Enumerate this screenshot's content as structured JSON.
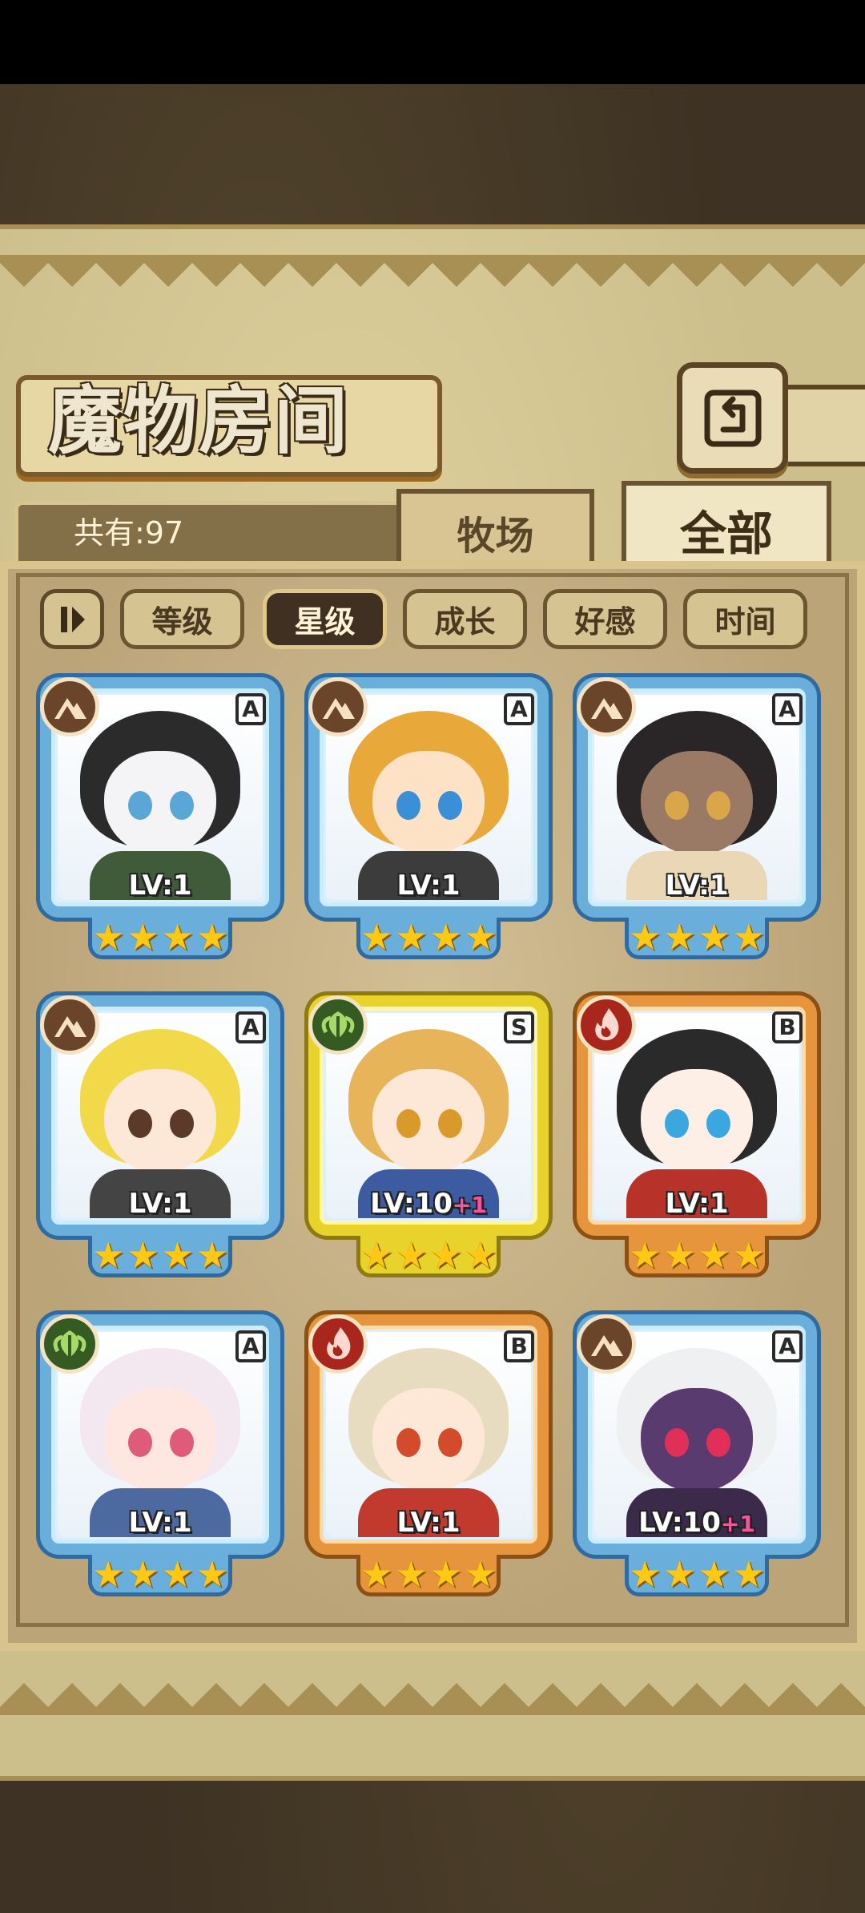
{
  "header": {
    "title": "魔物房间"
  },
  "count": {
    "label": "共有:97"
  },
  "tabs": [
    {
      "label": "牧场",
      "active": false
    },
    {
      "label": "全部",
      "active": true
    }
  ],
  "sort": {
    "buttons": [
      {
        "label": "等级",
        "active": false
      },
      {
        "label": "星级",
        "active": true
      },
      {
        "label": "成长",
        "active": false
      },
      {
        "label": "好感",
        "active": false
      },
      {
        "label": "时间",
        "active": false
      }
    ]
  },
  "cards": [
    {
      "element": "earth",
      "rank": "A",
      "level": "LV:1",
      "plus": "",
      "stars": 4,
      "frame": "blue",
      "colors": {
        "hair": "#2b2b2b",
        "face": "#f4f4f6",
        "eye": "#5aa6d6",
        "body": "#3f5b3a"
      }
    },
    {
      "element": "earth",
      "rank": "A",
      "level": "LV:1",
      "plus": "",
      "stars": 4,
      "frame": "blue",
      "colors": {
        "hair": "#e8a93a",
        "face": "#fde2c6",
        "eye": "#3a8fd6",
        "body": "#3c3c3c"
      }
    },
    {
      "element": "earth",
      "rank": "A",
      "level": "LV:1",
      "plus": "",
      "stars": 4,
      "frame": "blue",
      "colors": {
        "hair": "#2a2527",
        "face": "#9b7a65",
        "eye": "#d9a64a",
        "body": "#e9d7b5"
      }
    },
    {
      "element": "earth",
      "rank": "A",
      "level": "LV:1",
      "plus": "",
      "stars": 4,
      "frame": "blue",
      "colors": {
        "hair": "#f2d94a",
        "face": "#fde7d7",
        "eye": "#5b3a2a",
        "body": "#444444"
      }
    },
    {
      "element": "nature",
      "rank": "S",
      "level": "LV:10",
      "plus": "+1",
      "stars": 4,
      "frame": "gold",
      "colors": {
        "hair": "#e7b45a",
        "face": "#fde7d7",
        "eye": "#d99a2a",
        "body": "#3d5ba0"
      }
    },
    {
      "element": "fire",
      "rank": "B",
      "level": "LV:1",
      "plus": "",
      "stars": 4,
      "frame": "orange",
      "colors": {
        "hair": "#2a2a2a",
        "face": "#fdeee6",
        "eye": "#3aa7e0",
        "body": "#b73228"
      }
    },
    {
      "element": "nature",
      "rank": "A",
      "level": "LV:1",
      "plus": "",
      "stars": 4,
      "frame": "blue",
      "colors": {
        "hair": "#f3e8ef",
        "face": "#fde7e0",
        "eye": "#e05a7a",
        "body": "#4d6aa0"
      }
    },
    {
      "element": "fire",
      "rank": "B",
      "level": "LV:1",
      "plus": "",
      "stars": 4,
      "frame": "orange",
      "colors": {
        "hair": "#e8dcc0",
        "face": "#fde7d7",
        "eye": "#d34b2a",
        "body": "#c2392e"
      }
    },
    {
      "element": "earth",
      "rank": "A",
      "level": "LV:10",
      "plus": "+1",
      "stars": 4,
      "frame": "blue",
      "colors": {
        "hair": "#eef0f2",
        "face": "#5a3b6f",
        "eye": "#e0305a",
        "body": "#3b2a4a"
      }
    }
  ],
  "icons": {
    "back": "back-arrow-icon",
    "sort_toggle": "sort-order-icon",
    "earth": "mountain-icon",
    "nature": "leaf-icon",
    "fire": "flame-icon",
    "star": "star-icon"
  }
}
